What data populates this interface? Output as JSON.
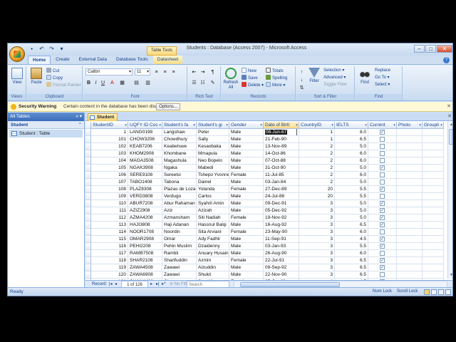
{
  "window": {
    "title": "Students : Database (Access 2007) - Microsoft Access",
    "context_tab_title": "Table Tools",
    "controls": [
      "–",
      "□",
      "✕"
    ]
  },
  "quick_access": [
    "save",
    "undo",
    "redo",
    "customize"
  ],
  "ribbon_tabs": [
    "Home",
    "Create",
    "External Data",
    "Database Tools",
    "Datasheet"
  ],
  "ribbon": {
    "views": {
      "view_label": "View",
      "group": "Views"
    },
    "clipboard": {
      "paste_label": "Paste",
      "cut": "Cut",
      "copy": "Copy",
      "format_painter": "Format Painter",
      "group": "Clipboard"
    },
    "font": {
      "font_name": "Calibri",
      "font_size": "11",
      "group": "Font"
    },
    "rich_text": {
      "group": "Rich Text"
    },
    "records": {
      "refresh": "Refresh All",
      "new": "New",
      "save": "Save",
      "delete": "Delete",
      "totals": "Totals",
      "spelling": "Spelling",
      "more": "More",
      "group": "Records"
    },
    "sort_filter": {
      "filter": "Filter",
      "selection": "Selection",
      "advanced": "Advanced",
      "toggle_filter": "Toggle Filter",
      "group": "Sort & Filter"
    },
    "find": {
      "find": "Find",
      "replace": "Replace",
      "goto": "Go To",
      "select": "Select",
      "group": "Find"
    }
  },
  "message_bar": {
    "title": "Security Warning",
    "text": "Certain content in the database has been disabled.",
    "options_label": "Options..."
  },
  "nav_pane": {
    "header": "All Tables",
    "group": "Student",
    "item": "Student : Table"
  },
  "document_tab": "Student",
  "table": {
    "columns": [
      "StudentID",
      "UQFY ID Coc",
      "Student's fa",
      "Student's gi",
      "Gender",
      "Date of Birtl",
      "CountryID",
      "IELTS",
      "Current",
      "Photo",
      "Groupli"
    ],
    "active_column": 5,
    "selected_cell": {
      "row": 0,
      "column": 5
    },
    "rows": [
      [
        "1",
        "LANG0198",
        "Langshaw",
        "Peter",
        "Male",
        "06-Jun-67",
        "1",
        "8.0",
        true
      ],
      [
        "101",
        "CHOW3206",
        "Chowdhury",
        "Sally",
        "Male",
        "21-Feb-90",
        "1",
        "6.5",
        false
      ],
      [
        "102",
        "KEAB7206",
        "Keabetswe",
        "Kesaobaka",
        "Male",
        "13-Nov-89",
        "2",
        "5.0",
        false
      ],
      [
        "103",
        "KHOM2908",
        "Khombane",
        "Mmapula",
        "Male",
        "14-Oct-86",
        "2",
        "6.0",
        false
      ],
      [
        "104",
        "MAGA3508",
        "Magashula",
        "Neo Bopelo",
        "Male",
        "07-Oct-88",
        "2",
        "6.0",
        false
      ],
      [
        "105",
        "NGAK3908",
        "Ngaka",
        "Mabedi",
        "Male",
        "31-Oct-90",
        "2",
        "5.0",
        true
      ],
      [
        "106",
        "SERE9108",
        "Sereetsi",
        "Tshepo Yvonne",
        "Female",
        "11-Jul-85",
        "2",
        "6.0",
        false
      ],
      [
        "107",
        "TABO1408",
        "Tabona",
        "Dainel",
        "Male",
        "03-Jan-84",
        "2",
        "5.0",
        false
      ],
      [
        "108",
        "PLAZ8308",
        "Plazas de Loza",
        "Yolanda",
        "Female",
        "27-Dec-89",
        "20",
        "5.5",
        true
      ],
      [
        "109",
        "VERD3808",
        "Verdugo",
        "Carlos",
        "Male",
        "24-Jul-88",
        "20",
        "5.5",
        false
      ],
      [
        "110",
        "ABUR7208",
        "Abur Rahaman",
        "Syahril Amin",
        "Male",
        "09-Dec-91",
        "3",
        "5.0",
        true
      ],
      [
        "111",
        "AZIZ2908",
        "Aziz",
        "Azizah",
        "Male",
        "05-Dec-92",
        "3",
        "5.0",
        true
      ],
      [
        "112",
        "AZMA4208",
        "Azmansham",
        "Siti Nadiah",
        "Female",
        "19-Nov-92",
        "3",
        "5.0",
        true
      ],
      [
        "113",
        "HAJI3808",
        "Haji Adanan",
        "Hassnul Balqi",
        "Male",
        "16-Aug-92",
        "3",
        "6.5",
        true
      ],
      [
        "114",
        "NOOR1708",
        "Noordin",
        "Sita Arviani",
        "Female",
        "23-May-90",
        "3",
        "6.0",
        false
      ],
      [
        "115",
        "OMAR2908",
        "Omar",
        "Ady Fadhli",
        "Male",
        "11-Sep-91",
        "3",
        "4.5",
        true
      ],
      [
        "116",
        "PEHI2208",
        "Pehin Muslim",
        "Dzaidenny",
        "Male",
        "03-Jan-93",
        "3",
        "5.5",
        true
      ],
      [
        "117",
        "RAMB7508",
        "Rambli",
        "Anuary Husain",
        "Male",
        "26-Aug-90",
        "3",
        "6.0",
        false
      ],
      [
        "118",
        "SHAR2108",
        "Sharifuddin",
        "Azmin",
        "Female",
        "22-Jul-91",
        "3",
        "6.5",
        true
      ],
      [
        "119",
        "ZAWA4508",
        "Zawawi",
        "Aizuddin",
        "Male",
        "09-Sep-92",
        "3",
        "6.5",
        true
      ],
      [
        "120",
        "ZAWA6908",
        "Zawawi",
        "Shukri",
        "Male",
        "22-Nov-90",
        "3",
        "6.5",
        false
      ],
      [
        "121",
        "CHAN4408",
        "Chan",
        "Suet Ying",
        "Female",
        "27-Oct-88",
        "4",
        "4.5",
        false
      ]
    ]
  },
  "record_nav": {
    "label": "Record:",
    "position": "1 of 126",
    "filter": "No Filter",
    "search": "Search"
  },
  "status_bar": {
    "text": "Ready",
    "num_lock": "Num Lock",
    "scroll_lock": "Scroll Lock"
  },
  "colors": {
    "accent": "#15428b",
    "active_tab": "#f6d26f",
    "ribbon": "#d9e6f5"
  }
}
